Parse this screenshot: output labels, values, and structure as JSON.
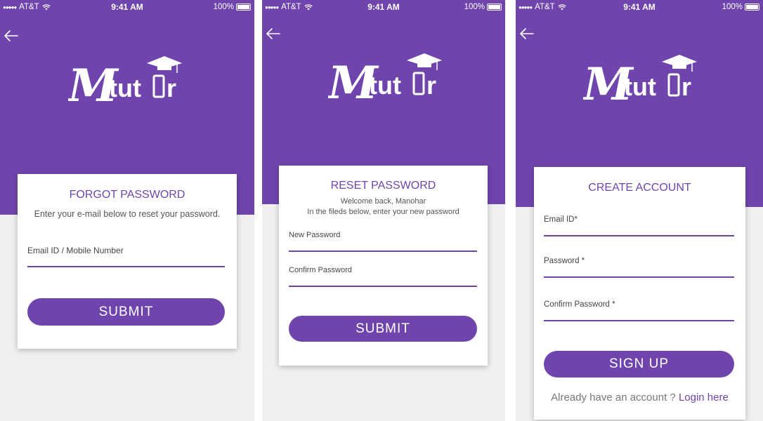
{
  "status_bar": {
    "carrier": "AT&T",
    "time": "9:41 AM",
    "battery": "100%"
  },
  "brand": {
    "logo_text": "Mtutor",
    "color": "#6f45ad"
  },
  "screens": [
    {
      "title": "FORGOT PASSWORD",
      "subtitle": "Enter your e-mail below to reset your password.",
      "field_label": "Email ID / Mobile Number",
      "button": "SUBMIT"
    },
    {
      "title": "RESET PASSWORD",
      "welcome": "Welcome back, Manohar",
      "instruction": "In the fileds below, enter your new password",
      "new_password_label": "New Password",
      "confirm_password_label": "Confirm Password",
      "button": "SUBMIT"
    },
    {
      "title": "CREATE ACCOUNT",
      "email_label": "Email ID*",
      "password_label": "Password *",
      "confirm_password_label": "Confirm Password *",
      "button": "SIGN UP",
      "login_prompt": "Already have an account ?",
      "login_link": "Login here"
    }
  ]
}
